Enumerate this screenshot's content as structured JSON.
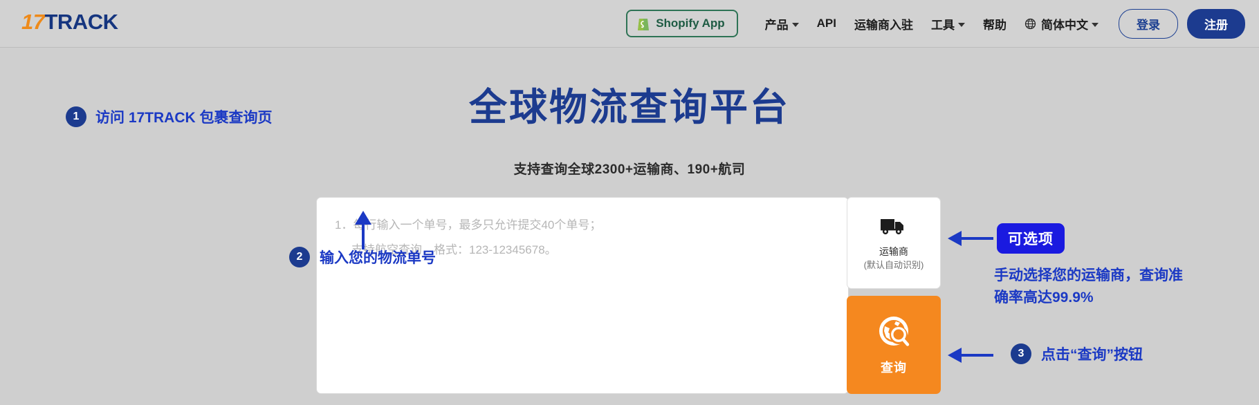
{
  "header": {
    "logo": {
      "part1": "17",
      "part2": "TRACK"
    },
    "shopify_button": {
      "label": "Shopify App",
      "icon": "shopify-bag-icon",
      "border_color": "#2e7355"
    },
    "nav_items": [
      {
        "label": "产品",
        "has_caret": true
      },
      {
        "label": "API",
        "has_caret": false
      },
      {
        "label": "运输商入驻",
        "has_caret": false
      },
      {
        "label": "工具",
        "has_caret": true
      },
      {
        "label": "帮助",
        "has_caret": false
      }
    ],
    "language": {
      "label": "简体中文",
      "icon": "globe-icon",
      "has_caret": true
    },
    "login_label": "登录",
    "register_label": "注册",
    "accent_color": "#1c3b8f",
    "background": "#d2d2d2"
  },
  "hero": {
    "title": "全球物流查询平台",
    "subtitle": "支持查询全球2300+运输商、190+航司",
    "title_color": "#1c3b8f"
  },
  "form": {
    "placeholder_line1": "1．每行输入一个单号，最多只允许提交40个单号；",
    "placeholder_line2": "支持航空查询，格式：123-12345678。",
    "carrier": {
      "icon": "truck-icon",
      "label": "运输商",
      "sublabel": "(默认自动识别)"
    },
    "search_button": {
      "icon": "globe-search-icon",
      "label": "查询",
      "color": "#f5881f"
    }
  },
  "annotations": {
    "step1": {
      "number": "1",
      "text": "访问 17TRACK 包裹查询页"
    },
    "step2": {
      "number": "2",
      "text": "输入您的物流单号",
      "arrow": "arrow-up-icon"
    },
    "step3": {
      "number": "3",
      "text": "点击“查询”按钮",
      "arrow": "arrow-left-icon"
    },
    "optional_badge": {
      "text": "可选项",
      "color": "#1a1ae0",
      "arrow": "arrow-left-icon"
    },
    "note_line1": "手动选择您的运输商，查询准",
    "note_line2": "确率高达99.9%",
    "text_color": "#1b39c4"
  }
}
